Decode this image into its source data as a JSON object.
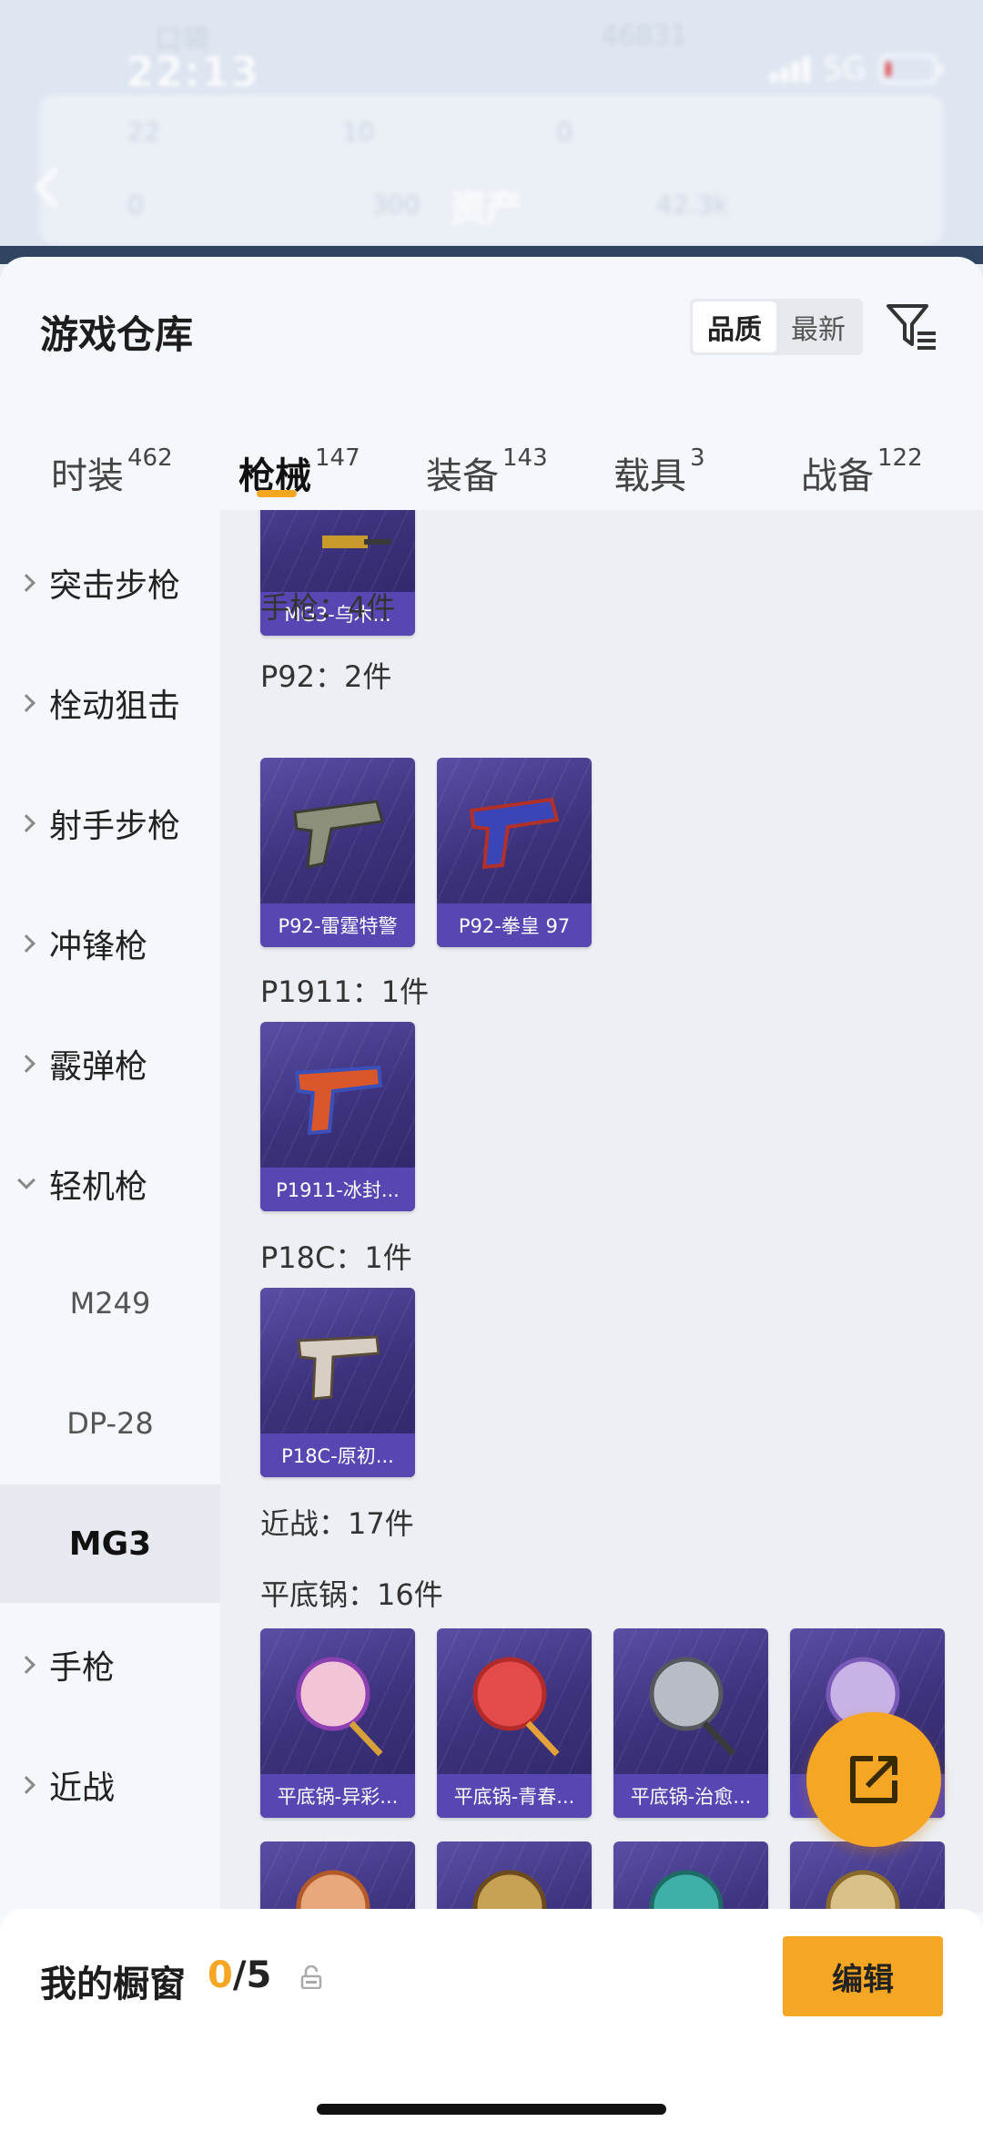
{
  "status_bar": {
    "time": "22:13",
    "network": "5G",
    "top_left_blur": "口袋",
    "top_center_blur": "46831"
  },
  "background": {
    "asset_title": "资产",
    "stats_row1": [
      "22",
      "10",
      "0"
    ],
    "stats_row2": [
      "0",
      "300",
      "42.3k"
    ]
  },
  "header": {
    "title": "游戏仓库",
    "sort_options": [
      "品质",
      "最新"
    ],
    "active_sort": "品质"
  },
  "tabs": [
    {
      "label": "时装",
      "count": "462"
    },
    {
      "label": "枪械",
      "count": "147"
    },
    {
      "label": "装备",
      "count": "143"
    },
    {
      "label": "载具",
      "count": "3"
    },
    {
      "label": "战备",
      "count": "122"
    }
  ],
  "active_tab": "枪械",
  "categories": {
    "items": [
      "突击步枪",
      "栓动狙击",
      "射手步枪",
      "冲锋枪",
      "霰弹枪",
      "轻机枪"
    ],
    "expanded": "轻机枪",
    "subitems": [
      "M249",
      "DP-28",
      "MG3"
    ],
    "active_subitem": "MG3",
    "items_after": [
      "手枪",
      "近战"
    ]
  },
  "content": {
    "top_item": "MG3-乌木...",
    "pistol_label": "手枪：4件",
    "p92_label": "P92：2件",
    "p92_items": [
      "P92-雷霆特警",
      "P92-拳皇 97"
    ],
    "p1911_label": "P1911：1件",
    "p1911_items": [
      "P1911-冰封..."
    ],
    "p18c_label": "P18C：1件",
    "p18c_items": [
      "P18C-原初..."
    ],
    "melee_label": "近战：17件",
    "pan_label": "平底锅：16件",
    "pan_items": [
      "平底锅-异彩...",
      "平底锅-青春...",
      "平底锅-治愈...",
      ""
    ]
  },
  "bottom_bar": {
    "showcase_label": "我的橱窗",
    "showcase_current": "0",
    "showcase_total": "/5",
    "edit_label": "编辑"
  },
  "colors": {
    "accent": "#f5a623",
    "card_bg": "#3d337e",
    "card_caption": "#5847b2"
  },
  "icons": [
    "back-chevron-icon",
    "filter-icon",
    "chevron-right-icon",
    "chevron-down-icon",
    "lock-icon",
    "share-export-icon"
  ]
}
